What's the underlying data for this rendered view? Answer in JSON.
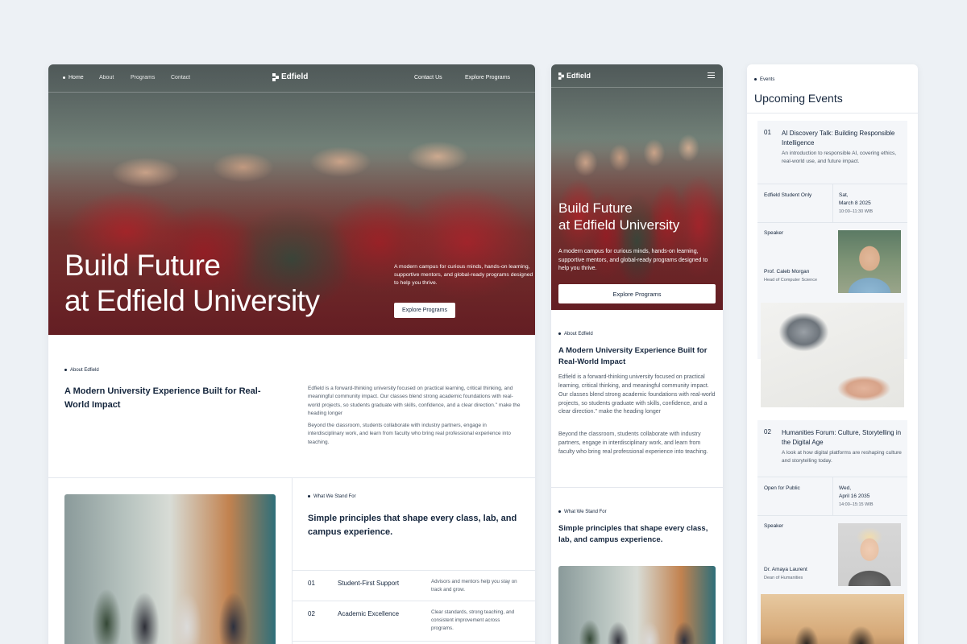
{
  "brand": "Edfield",
  "desktop": {
    "nav": [
      "Home",
      "About",
      "Programs",
      "Contact"
    ],
    "nav_right": [
      "Contact Us",
      "Explore Programs"
    ],
    "hero_title_1": "Build Future",
    "hero_title_2": "at Edfield University",
    "hero_text": "A modern campus for curious minds, hands-on learning, supportive mentors, and global-ready programs designed to help you thrive.",
    "hero_cta": "Explore Programs",
    "about_tag": "About Edfield",
    "about_heading": "A Modern University Experience Built for Real-World Impact",
    "about_p1": "Edfield is a forward-thinking university focused on practical learning, critical thinking, and meaningful community impact. Our classes blend strong academic foundations with real-world projects, so students graduate with skills, confidence, and a clear direction.\" make the heading longer",
    "about_p2": "Beyond the classroom, students collaborate with industry partners, engage in interdisciplinary work, and learn from faculty who bring real professional experience into teaching.",
    "stand_tag": "What We Stand For",
    "stand_heading": "Simple principles that shape every class, lab, and campus experience.",
    "principles": [
      {
        "num": "01",
        "title": "Student-First Support",
        "desc": "Advisors and mentors help you stay on track and grow."
      },
      {
        "num": "02",
        "title": "Academic Excellence",
        "desc": "Clear standards, strong teaching, and consistent improvement across programs."
      }
    ]
  },
  "mobile": {
    "hero_title_1": "Build Future",
    "hero_title_2": "at Edfield University",
    "hero_text": "A modern campus for curious minds, hands-on learning, supportive mentors, and global-ready programs designed to help you thrive.",
    "hero_cta": "Explore Programs",
    "about_tag": "About Edfield",
    "about_heading": "A Modern University Experience Built for Real-World Impact",
    "about_p1": "Edfield is a forward-thinking university focused on practical learning, critical thinking, and meaningful community impact. Our classes blend strong academic foundations with real-world projects, so students graduate with skills, confidence, and a clear direction.\" make the heading longer",
    "about_p2": "Beyond the classroom, students collaborate with industry partners, engage in interdisciplinary work, and learn from faculty who bring real professional experience into teaching.",
    "stand_tag": "What We Stand For",
    "stand_heading": "Simple principles that shape every class, lab, and campus experience."
  },
  "events": {
    "tag": "Events",
    "title": "Upcoming Events",
    "items": [
      {
        "num": "01",
        "title": "AI Discovery Talk: Building Responsible Intelligence",
        "desc": "An introduction to responsible AI, covering ethics, real-world use, and future impact.",
        "audience": "Edfield Student Only",
        "day": "Sat,",
        "date": "March 8 2025",
        "time": "10:00–11:30 WIB",
        "speaker_label": "Speaker",
        "speaker_name": "Prof. Caleb Morgan",
        "speaker_role": "Head of Computer Science"
      },
      {
        "num": "02",
        "title": "Humanities Forum: Culture, Storytelling in the Digital Age",
        "desc": "A look at how digital platforms are reshaping culture and storytelling today.",
        "audience": "Open for Public",
        "day": "Wed,",
        "date": "April 16 2035",
        "time": "14:00–15:15 WIB",
        "speaker_label": "Speaker",
        "speaker_name": "Dr. Amaya Laurent",
        "speaker_role": "Dean of Humanities"
      }
    ]
  }
}
